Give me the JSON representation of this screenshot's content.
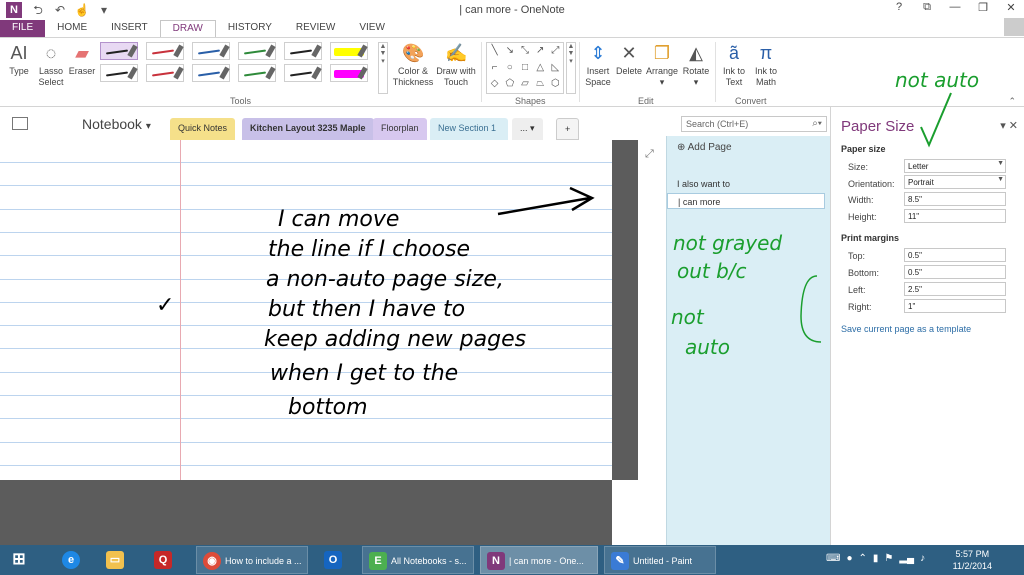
{
  "window": {
    "title": "| can more - OneNote",
    "controls": [
      "?",
      "⧉",
      "—",
      "❐",
      "✕"
    ]
  },
  "ribbon_tabs": [
    "FILE",
    "HOME",
    "INSERT",
    "DRAW",
    "HISTORY",
    "REVIEW",
    "VIEW"
  ],
  "ribbon": {
    "type": "Type",
    "lasso_line1": "Lasso",
    "lasso_line2": "Select",
    "eraser": "Eraser",
    "color_line1": "Color &",
    "color_line2": "Thickness",
    "draw_line1": "Draw with",
    "draw_line2": "Touch",
    "insert_line1": "Insert",
    "insert_line2": "Space",
    "delete": "Delete",
    "arrange": "Arrange",
    "rotate": "Rotate",
    "ink_text_line1": "Ink to",
    "ink_text_line2": "Text",
    "ink_math_line1": "Ink to",
    "ink_math_line2": "Math",
    "group_tools": "Tools",
    "group_shapes": "Shapes",
    "group_edit": "Edit",
    "group_convert": "Convert",
    "pen_colors": [
      "#222222",
      "#c8323c",
      "#2a5fa8",
      "#2e8a3a",
      "#222222",
      "#ffff00",
      "#222222",
      "#c8323c",
      "#2a5fa8",
      "#2e8a3a",
      "#222222",
      "#ff00ff"
    ]
  },
  "notebook": {
    "name": "Notebook",
    "sections": [
      {
        "label": "Quick Notes",
        "color": "#f5e08a"
      },
      {
        "label": "Kitchen Layout 3235 Maple",
        "color": "#c8c0e8"
      },
      {
        "label": "Floorplan",
        "color": "#d7c8ef"
      },
      {
        "label": "New Section 1",
        "color": "#daeef5"
      }
    ],
    "more": "...",
    "add": "+",
    "search_placeholder": "Search (Ctrl+E)"
  },
  "pages": {
    "add_page": "Add Page",
    "items": [
      "I also want to",
      "| can more"
    ]
  },
  "ink": {
    "lines": [
      "I can move",
      "the line if I choose",
      "a non-auto page size,",
      "but then I have to",
      "keep adding new pages",
      "when I get to the",
      "bottom"
    ],
    "check": "✓",
    "note_top": "not auto",
    "note_mid1": "not grayed",
    "note_mid2": "out b/c",
    "note_bottom1": "not",
    "note_bottom2": "auto"
  },
  "paper_pane": {
    "title": "Paper Size",
    "paper_size_heading": "Paper size",
    "size_label": "Size:",
    "size_value": "Letter",
    "orientation_label": "Orientation:",
    "orientation_value": "Portrait",
    "width_label": "Width:",
    "width_value": "8.5\"",
    "height_label": "Height:",
    "height_value": "11\"",
    "margins_heading": "Print margins",
    "top_label": "Top:",
    "top_value": "0.5\"",
    "bottom_label": "Bottom:",
    "bottom_value": "0.5\"",
    "left_label": "Left:",
    "left_value": "2.5\"",
    "right_label": "Right:",
    "right_value": "1\"",
    "save_link": "Save current page as a template"
  },
  "taskbar": {
    "items": [
      {
        "label": "How to include a ...",
        "color": "#dd4b39"
      },
      {
        "label": "All Notebooks - s...",
        "color": "#4caf50"
      },
      {
        "label": "| can more - One...",
        "color": "#80397b"
      },
      {
        "label": "Untitled - Paint",
        "color": "#3a7bd5"
      }
    ],
    "time": "5:57 PM",
    "date": "11/2/2014"
  }
}
